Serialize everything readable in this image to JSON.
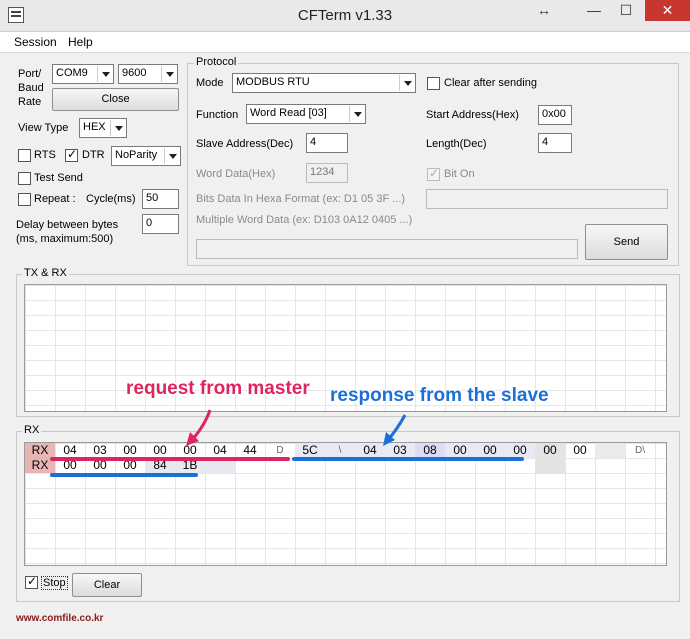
{
  "window": {
    "title": "CFTerm v1.33",
    "move_glyph": "↔",
    "min_glyph": "—",
    "max_glyph": "☐",
    "close_glyph": "✕"
  },
  "menu": {
    "session": "Session",
    "help": "Help"
  },
  "port": {
    "label": "Port/\nBaud\nRate",
    "port_value": "COM9",
    "baud_value": "9600",
    "close_label": "Close"
  },
  "view_type": {
    "label": "View Type",
    "value": "HEX"
  },
  "rts": {
    "label": "RTS",
    "checked": false
  },
  "dtr": {
    "label": "DTR",
    "checked": true
  },
  "parity": {
    "value": "NoParity"
  },
  "test_send": {
    "label": "Test Send"
  },
  "repeat": {
    "label": "Repeat :",
    "cycle_label": "Cycle(ms)",
    "cycle_value": "50"
  },
  "delay": {
    "label": "Delay between bytes\n(ms, maximum:500)",
    "value": "0"
  },
  "protocol": {
    "group_label": "Protocol",
    "mode_label": "Mode",
    "mode_value": "MODBUS RTU",
    "clear_after_sending": "Clear after sending",
    "function_label": "Function",
    "function_value": "Word Read [03]",
    "start_address_label": "Start Address(Hex)",
    "start_address_value": "0x00",
    "slave_address_label": "Slave Address(Dec)",
    "slave_address_value": "4",
    "length_label": "Length(Dec)",
    "length_value": "4",
    "word_data_label": "Word Data(Hex)",
    "word_data_value": "1234",
    "bit_on_label": "Bit On",
    "bits_data_hint": "Bits Data In Hexa Format (ex: D1 05 3F ...)",
    "multi_word_hint": "Multiple Word Data (ex: D103 0A12 0405 ...)",
    "send_label": "Send"
  },
  "txrx": {
    "group_label": "TX & RX"
  },
  "rx": {
    "group_label": "RX",
    "row1_tag": "RX",
    "row1": [
      "04",
      "03",
      "00",
      "00",
      "00",
      "04",
      "44",
      "D",
      "5C",
      "\\",
      "04",
      "03",
      "08",
      "00",
      "00",
      "00",
      "00",
      "00",
      "",
      "D\\"
    ],
    "row2_tag": "RX",
    "row2": [
      "00",
      "00",
      "00",
      "84",
      "1B"
    ]
  },
  "annotations": {
    "request": "request from master",
    "response": "response from the slave",
    "request_color": "#e0245e",
    "response_color": "#1a6fd8"
  },
  "bottom": {
    "stop_label": "Stop",
    "stop_checked": true,
    "clear_label": "Clear",
    "website": "www.comfile.co.kr"
  }
}
